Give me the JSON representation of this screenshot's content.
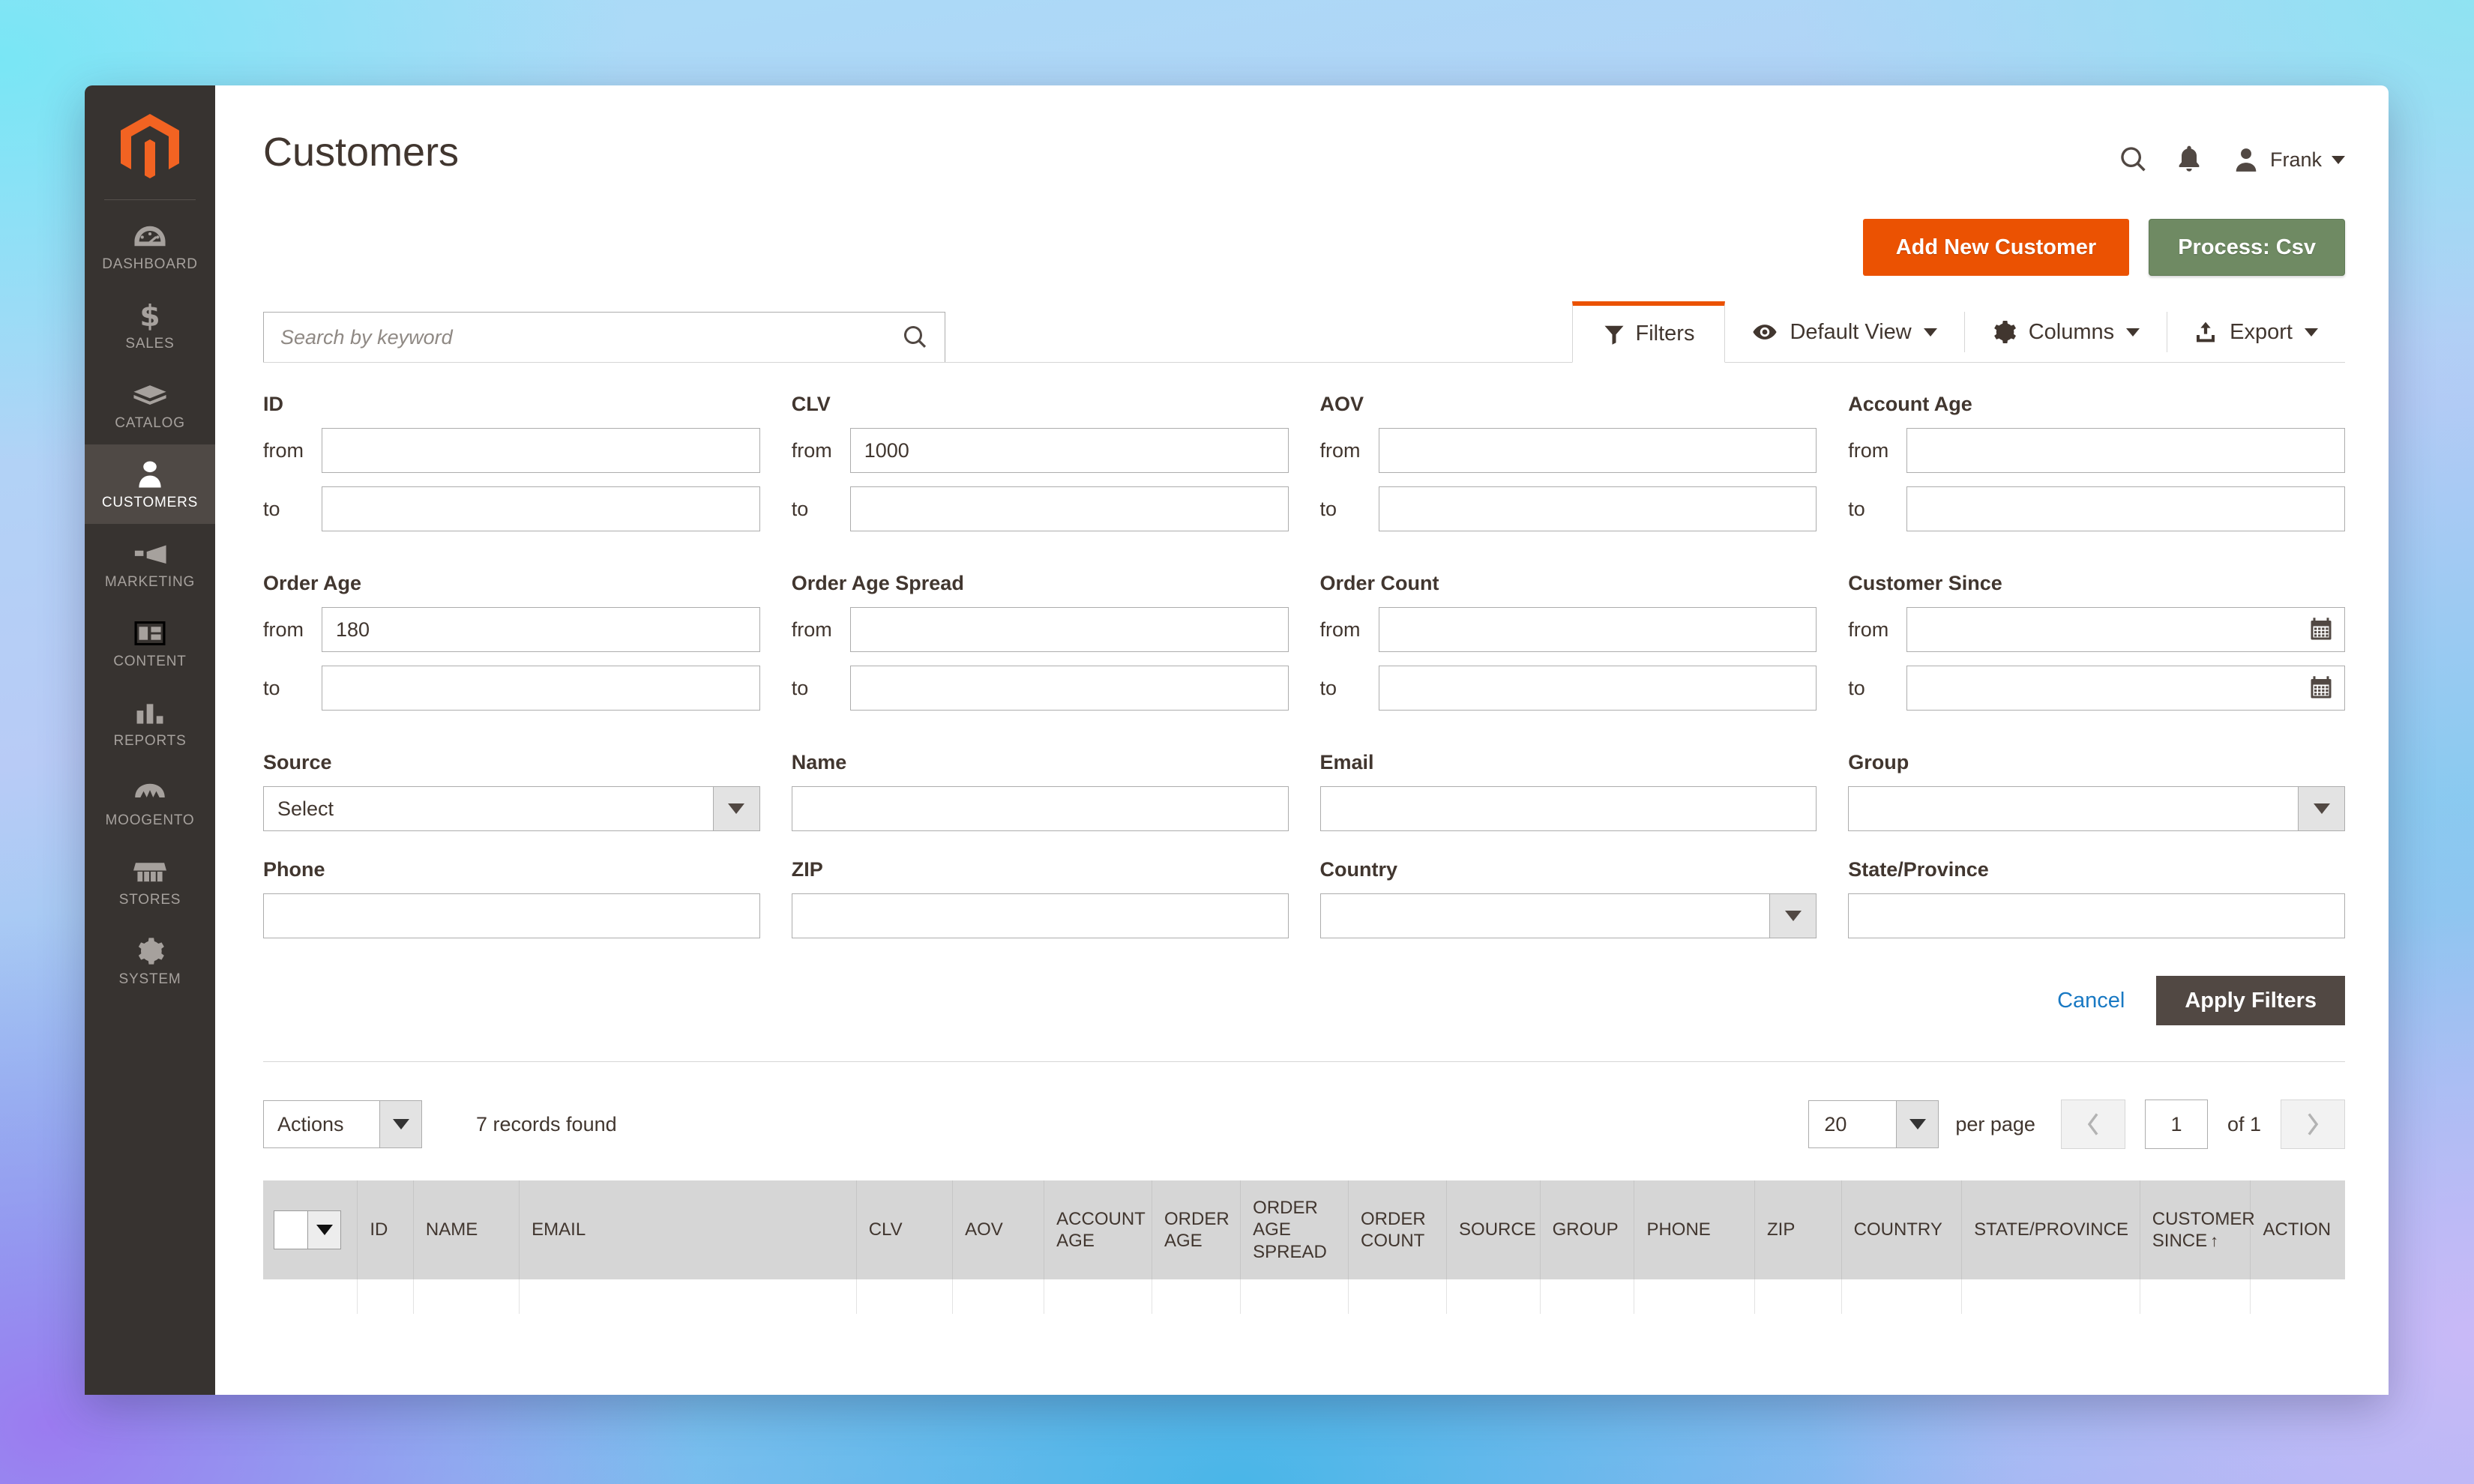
{
  "sidebar": {
    "logo_name": "magento-logo",
    "items": [
      {
        "label": "DASHBOARD",
        "icon": "dashboard-icon",
        "active": false
      },
      {
        "label": "SALES",
        "icon": "dollar-icon",
        "active": false
      },
      {
        "label": "CATALOG",
        "icon": "box-icon",
        "active": false
      },
      {
        "label": "CUSTOMERS",
        "icon": "person-icon",
        "active": true
      },
      {
        "label": "MARKETING",
        "icon": "megaphone-icon",
        "active": false
      },
      {
        "label": "CONTENT",
        "icon": "layout-icon",
        "active": false
      },
      {
        "label": "REPORTS",
        "icon": "bar-chart-icon",
        "active": false
      },
      {
        "label": "MOOGENTO",
        "icon": "moogento-icon",
        "active": false
      },
      {
        "label": "STORES",
        "icon": "storefront-icon",
        "active": false
      },
      {
        "label": "SYSTEM",
        "icon": "gear-icon",
        "active": false
      }
    ]
  },
  "header": {
    "title": "Customers",
    "search_icon": "search-icon",
    "notifications_icon": "bell-icon",
    "avatar_icon": "user-avatar-icon",
    "user_name": "Frank"
  },
  "page_actions": {
    "add_new_customer": "Add New Customer",
    "process_csv": "Process: Csv"
  },
  "search": {
    "value": "",
    "placeholder": "Search by keyword"
  },
  "toolbar": {
    "filters": "Filters",
    "default_view": "Default View",
    "columns": "Columns",
    "export": "Export"
  },
  "filters": {
    "prefix_from": "from",
    "prefix_to": "to",
    "fields": [
      {
        "label": "ID",
        "type": "range",
        "from": "",
        "to": ""
      },
      {
        "label": "CLV",
        "type": "range",
        "from": "1000",
        "to": ""
      },
      {
        "label": "AOV",
        "type": "range",
        "from": "",
        "to": ""
      },
      {
        "label": "Account Age",
        "type": "range",
        "from": "",
        "to": ""
      },
      {
        "label": "Order Age",
        "type": "range",
        "from": "180",
        "to": ""
      },
      {
        "label": "Order Age Spread",
        "type": "range",
        "from": "",
        "to": ""
      },
      {
        "label": "Order Count",
        "type": "range",
        "from": "",
        "to": ""
      },
      {
        "label": "Customer Since",
        "type": "daterange",
        "from": "",
        "to": ""
      },
      {
        "label": "Source",
        "type": "select",
        "value": "Select"
      },
      {
        "label": "Name",
        "type": "text",
        "value": ""
      },
      {
        "label": "Email",
        "type": "text",
        "value": ""
      },
      {
        "label": "Group",
        "type": "select",
        "value": ""
      },
      {
        "label": "Phone",
        "type": "text",
        "value": ""
      },
      {
        "label": "ZIP",
        "type": "text",
        "value": ""
      },
      {
        "label": "Country",
        "type": "select",
        "value": ""
      },
      {
        "label": "State/Province",
        "type": "text",
        "value": ""
      }
    ],
    "cancel": "Cancel",
    "apply": "Apply Filters"
  },
  "grid_controls": {
    "actions_label": "Actions",
    "records_found": "7 records found",
    "per_page_value": "20",
    "per_page_label": "per page",
    "page_value": "1",
    "page_of": "of 1"
  },
  "table": {
    "columns": [
      "ID",
      "NAME",
      "EMAIL",
      "CLV",
      "AOV",
      "ACCOUNT AGE",
      "ORDER AGE",
      "ORDER AGE SPREAD",
      "ORDER COUNT",
      "SOURCE",
      "GROUP",
      "PHONE",
      "ZIP",
      "COUNTRY",
      "STATE/PROVINCE",
      "CUSTOMER SINCE",
      "ACTION"
    ],
    "sorted_column": "CUSTOMER SINCE",
    "sort_direction": "↑"
  },
  "colors": {
    "accent_orange": "#eb5202",
    "green_button": "#6f8a63",
    "dark_brown": "#514843",
    "sidebar": "#373330",
    "link_blue": "#1979c3"
  }
}
